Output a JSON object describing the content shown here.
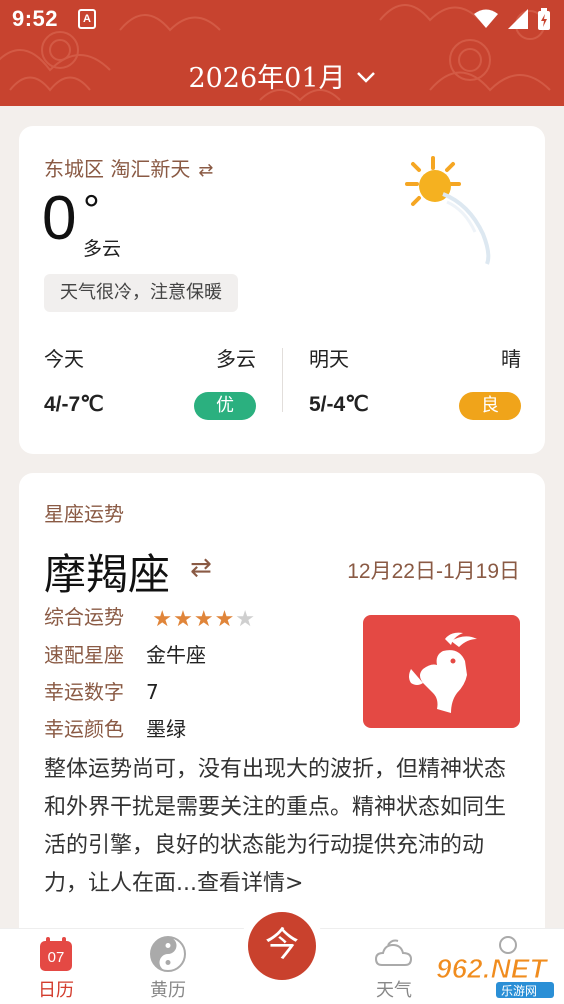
{
  "status_bar": {
    "time": "9:52",
    "notification_icon": "A"
  },
  "header": {
    "month": "2026年01月",
    "chevron": "chevron-down-icon",
    "accent": "#c7432f"
  },
  "weather": {
    "location": "东城区 淘汇新天",
    "swap_icon": "swap-icon",
    "temperature": "0",
    "degree": "°",
    "condition": "多云",
    "tip": "天气很冷，注意保暖",
    "today": {
      "label": "今天",
      "condition": "多云",
      "range": "4/-7℃",
      "aqi": "优",
      "aqi_color": "#2bb07f"
    },
    "tomorrow": {
      "label": "明天",
      "condition": "晴",
      "range": "5/-4℃",
      "aqi": "良",
      "aqi_color": "#f0a41a"
    }
  },
  "horoscope": {
    "section_title": "星座运势",
    "sign": "摩羯座",
    "date_range": "12月22日-1月19日",
    "rows": [
      {
        "key": "综合运势",
        "stars": 4,
        "max_stars": 5
      },
      {
        "key": "速配星座",
        "value": "金牛座"
      },
      {
        "key": "幸运数字",
        "value": "7"
      },
      {
        "key": "幸运颜色",
        "value": "墨绿"
      }
    ],
    "description": "整体运势尚可，没有出现大的波折，但精神状态和外界干扰是需要关注的重点。精神状态如同生活的引擎，良好的状态能为行动提供充沛的动力，让人在面...查看详情>",
    "badge_color": "#e44944"
  },
  "bottom_nav": {
    "items": [
      {
        "label": "日历",
        "icon": "calendar-icon",
        "badge": "07",
        "active": true
      },
      {
        "label": "黄历",
        "icon": "yin-yang-icon",
        "active": false
      },
      {
        "label": "天气",
        "icon": "cloud-icon",
        "active": false
      }
    ],
    "center_label": "今"
  },
  "watermark": {
    "brand": "962.NET",
    "sub": "乐游网"
  }
}
